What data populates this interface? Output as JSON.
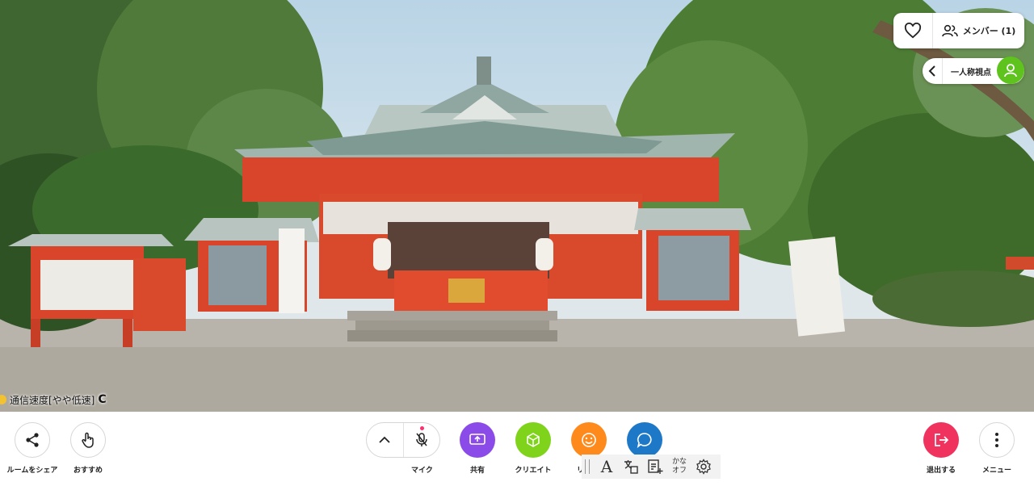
{
  "scene": {
    "description_hidden": ""
  },
  "top": {
    "favorite_icon": "heart-outline-icon",
    "members_label": "メンバー (1)",
    "members_icon": "people-icon",
    "view_label": "一人称視点",
    "view_back_icon": "chevron-left-icon",
    "avatar_icon": "person-icon",
    "avatar_color": "#5ec31d"
  },
  "status": {
    "network_label": "通信速度[やや低速]",
    "refresh_glyph": "C",
    "indicator_color": "#f2c230"
  },
  "toolbar": {
    "share_label": "ルームをシェア",
    "recommend_label": "おすすめ",
    "mic_label": "マイク",
    "share_screen_label": "共有",
    "create_label": "クリエイト",
    "reaction_label": "リア",
    "exit_label": "退出する",
    "menu_label": "メニュー",
    "colors": {
      "share_screen": "#8b4be8",
      "create": "#7fd31a",
      "reaction": "#ff8a1c",
      "chat": "#1e78c8",
      "exit": "#f0325e"
    }
  },
  "a11y": {
    "font_glyph": "A",
    "kana_line1": "かな",
    "kana_line2": "オフ"
  }
}
